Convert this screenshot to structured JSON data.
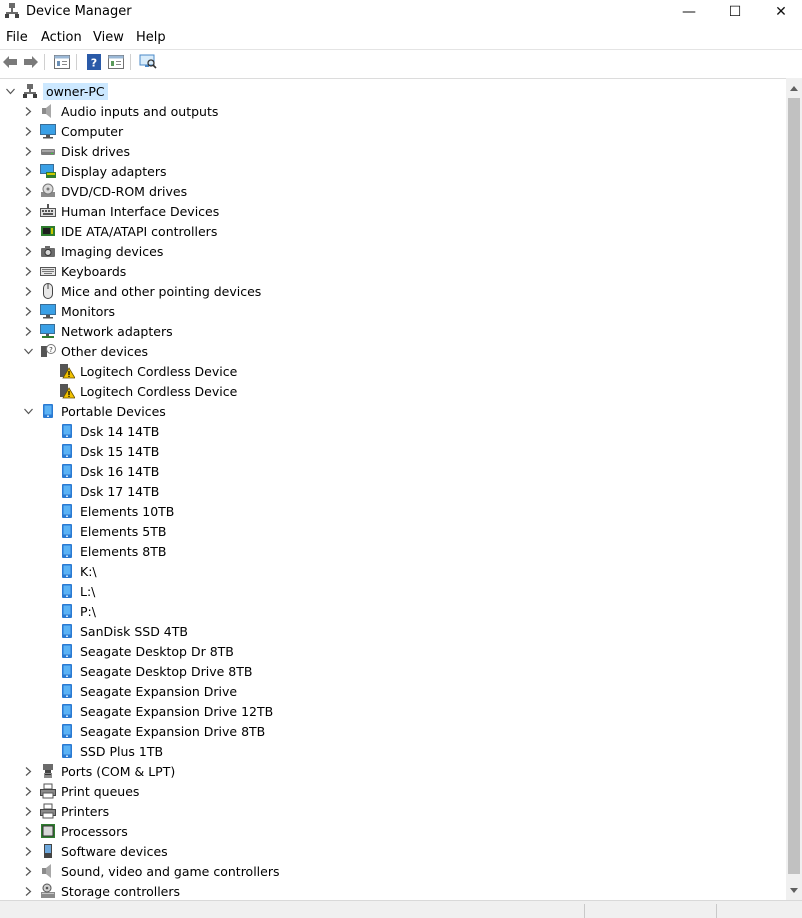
{
  "window": {
    "title": "Device Manager",
    "minimize": "—",
    "maximize": "☐",
    "close": "✕"
  },
  "menu": [
    {
      "label": "File"
    },
    {
      "label": "Action"
    },
    {
      "label": "View"
    },
    {
      "label": "Help"
    }
  ],
  "toolbar": {
    "buttons": [
      "back-icon",
      "forward-icon",
      "properties-icon",
      "help-icon",
      "details-icon",
      "scan-hardware-icon"
    ]
  },
  "tree": {
    "root": {
      "label": "owner-PC",
      "icon": "computer-icon",
      "expanded": true
    },
    "categories": [
      {
        "label": "Audio inputs and outputs",
        "icon": "speaker-icon",
        "expanded": false
      },
      {
        "label": "Computer",
        "icon": "monitor-icon",
        "expanded": false
      },
      {
        "label": "Disk drives",
        "icon": "disk-drive-icon",
        "expanded": false
      },
      {
        "label": "Display adapters",
        "icon": "display-adapter-icon",
        "expanded": false
      },
      {
        "label": "DVD/CD-ROM drives",
        "icon": "dvd-icon",
        "expanded": false
      },
      {
        "label": "Human Interface Devices",
        "icon": "hid-icon",
        "expanded": false
      },
      {
        "label": "IDE ATA/ATAPI controllers",
        "icon": "ide-controller-icon",
        "expanded": false
      },
      {
        "label": "Imaging devices",
        "icon": "camera-icon",
        "expanded": false
      },
      {
        "label": "Keyboards",
        "icon": "keyboard-icon",
        "expanded": false
      },
      {
        "label": "Mice and other pointing devices",
        "icon": "mouse-icon",
        "expanded": false
      },
      {
        "label": "Monitors",
        "icon": "monitor-icon",
        "expanded": false
      },
      {
        "label": "Network adapters",
        "icon": "network-icon",
        "expanded": false
      },
      {
        "label": "Other devices",
        "icon": "unknown-device-icon",
        "expanded": true,
        "children": [
          {
            "label": "Logitech Cordless Device",
            "icon": "warning-device-icon"
          },
          {
            "label": "Logitech Cordless Device",
            "icon": "warning-device-icon"
          }
        ]
      },
      {
        "label": "Portable Devices",
        "icon": "portable-device-icon",
        "expanded": true,
        "children": [
          {
            "label": "Dsk 14 14TB",
            "icon": "portable-device-icon"
          },
          {
            "label": "Dsk 15 14TB",
            "icon": "portable-device-icon"
          },
          {
            "label": "Dsk 16 14TB",
            "icon": "portable-device-icon"
          },
          {
            "label": "Dsk 17 14TB",
            "icon": "portable-device-icon"
          },
          {
            "label": "Elements 10TB",
            "icon": "portable-device-icon"
          },
          {
            "label": "Elements 5TB",
            "icon": "portable-device-icon"
          },
          {
            "label": "Elements 8TB",
            "icon": "portable-device-icon"
          },
          {
            "label": "K:\\",
            "icon": "portable-device-icon"
          },
          {
            "label": "L:\\",
            "icon": "portable-device-icon"
          },
          {
            "label": "P:\\",
            "icon": "portable-device-icon"
          },
          {
            "label": "SanDisk SSD 4TB",
            "icon": "portable-device-icon"
          },
          {
            "label": "Seagate Desktop Dr 8TB",
            "icon": "portable-device-icon"
          },
          {
            "label": "Seagate Desktop Drive 8TB",
            "icon": "portable-device-icon"
          },
          {
            "label": "Seagate Expansion Drive",
            "icon": "portable-device-icon"
          },
          {
            "label": "Seagate Expansion Drive 12TB",
            "icon": "portable-device-icon"
          },
          {
            "label": "Seagate Expansion Drive 8TB",
            "icon": "portable-device-icon"
          },
          {
            "label": "SSD Plus 1TB",
            "icon": "portable-device-icon"
          }
        ]
      },
      {
        "label": "Ports (COM & LPT)",
        "icon": "port-icon",
        "expanded": false
      },
      {
        "label": "Print queues",
        "icon": "printer-icon",
        "expanded": false
      },
      {
        "label": "Printers",
        "icon": "printer-icon",
        "expanded": false
      },
      {
        "label": "Processors",
        "icon": "processor-icon",
        "expanded": false
      },
      {
        "label": "Software devices",
        "icon": "software-device-icon",
        "expanded": false
      },
      {
        "label": "Sound, video and game controllers",
        "icon": "speaker-icon",
        "expanded": false
      },
      {
        "label": "Storage controllers",
        "icon": "storage-controller-icon",
        "expanded": false
      }
    ]
  },
  "colors": {
    "selection": "#cce8ff",
    "accent": "#1e88e5",
    "warning": "#f2c200"
  }
}
